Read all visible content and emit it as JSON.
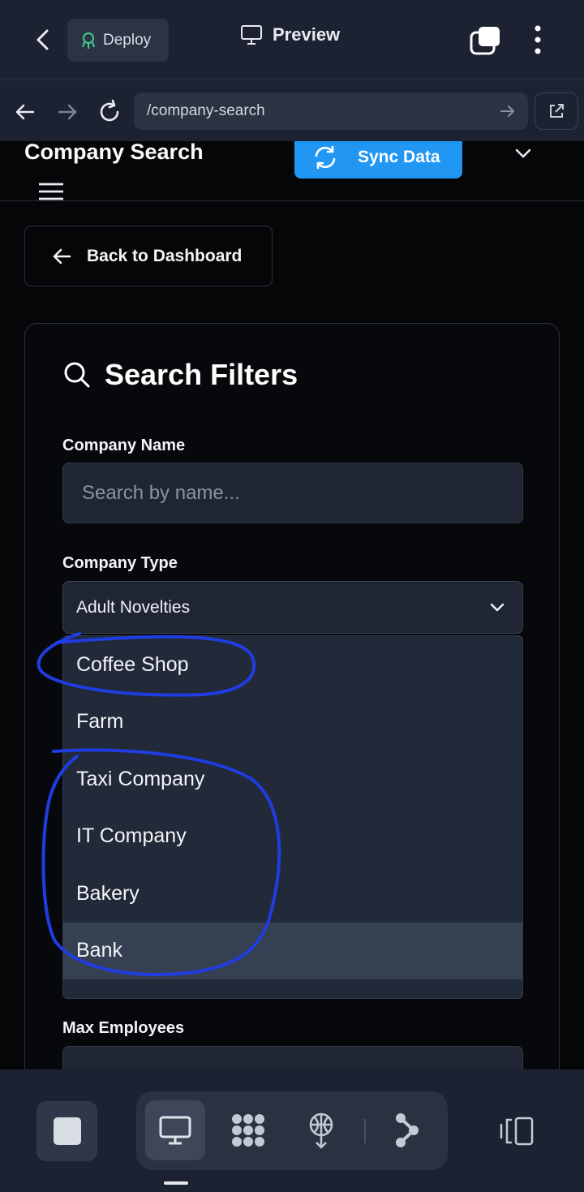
{
  "appbar": {
    "deploy_label": "Deploy",
    "preview_label": "Preview"
  },
  "browser": {
    "url": "/company-search"
  },
  "header": {
    "title": "Company Search",
    "sync_label": "Sync Data"
  },
  "back_label": "Back to Dashboard",
  "filters": {
    "title": "Search Filters",
    "company_name_label": "Company Name",
    "company_name_placeholder": "Search by name...",
    "company_type_label": "Company Type",
    "company_type_value": "Adult Novelties",
    "options": [
      "Coffee Shop",
      "Farm",
      "Taxi Company",
      "IT Company",
      "Bakery",
      "Bank"
    ],
    "highlighted_option": "Bank",
    "max_employees_label": "Max Employees"
  },
  "colors": {
    "accent": "#2196f3",
    "annotation_ink": "#1f3de0"
  }
}
